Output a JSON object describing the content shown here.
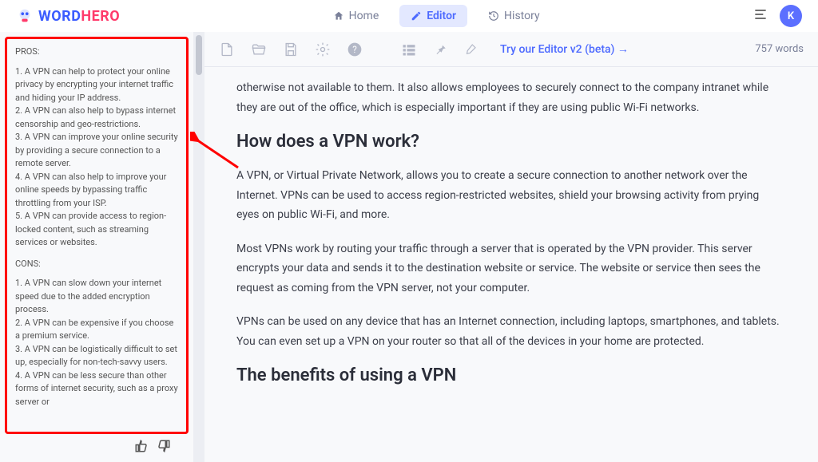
{
  "logo": {
    "word": "WORD",
    "hero": "HERO"
  },
  "nav": {
    "home": "Home",
    "editor": "Editor",
    "history": "History"
  },
  "avatar": "K",
  "toolbar": {
    "try": "Try our Editor v2 (beta) →",
    "word_count": "757 words"
  },
  "sidebar": {
    "pros_title": "PROS:",
    "pros": [
      "1. A VPN can help to protect your online privacy by encrypting your internet traffic and hiding your IP address.",
      "2. A VPN can also help to bypass internet censorship and geo-restrictions.",
      "3. A VPN can improve your online security by providing a secure connection to a remote server.",
      "4. A VPN can also help to improve your online speeds by bypassing traffic throttling from your ISP.",
      "5. A VPN can provide access to region-locked content, such as streaming services or websites."
    ],
    "cons_title": "CONS:",
    "cons": [
      "1. A VPN can slow down your internet speed due to the added encryption process.",
      "2. A VPN can be expensive if you choose a premium service.",
      "3. A VPN can be logistically difficult to set up, especially for non-tech-savvy users.",
      "4. A VPN can be less secure than other forms of internet security, such as a proxy server or"
    ]
  },
  "content": {
    "p1": "otherwise not available to them. It also allows employees to securely connect to the company intranet while they are out of the office, which is especially important if they are using public Wi-Fi networks.",
    "h1": "How does a VPN work?",
    "p2": "A VPN, or Virtual Private Network, allows you to create a secure connection to another network over the Internet. VPNs can be used to access region-restricted websites, shield your browsing activity from prying eyes on public Wi-Fi, and more.",
    "p3": "Most VPNs work by routing your traffic through a server that is operated by the VPN provider. This server encrypts your data and sends it to the destination website or service. The website or service then sees the request as coming from the VPN server, not your computer.",
    "p4": "VPNs can be used on any device that has an Internet connection, including laptops, smartphones, and tablets. You can even set up a VPN on your router so that all of the devices in your home are protected.",
    "h2": "The benefits of using a VPN"
  }
}
